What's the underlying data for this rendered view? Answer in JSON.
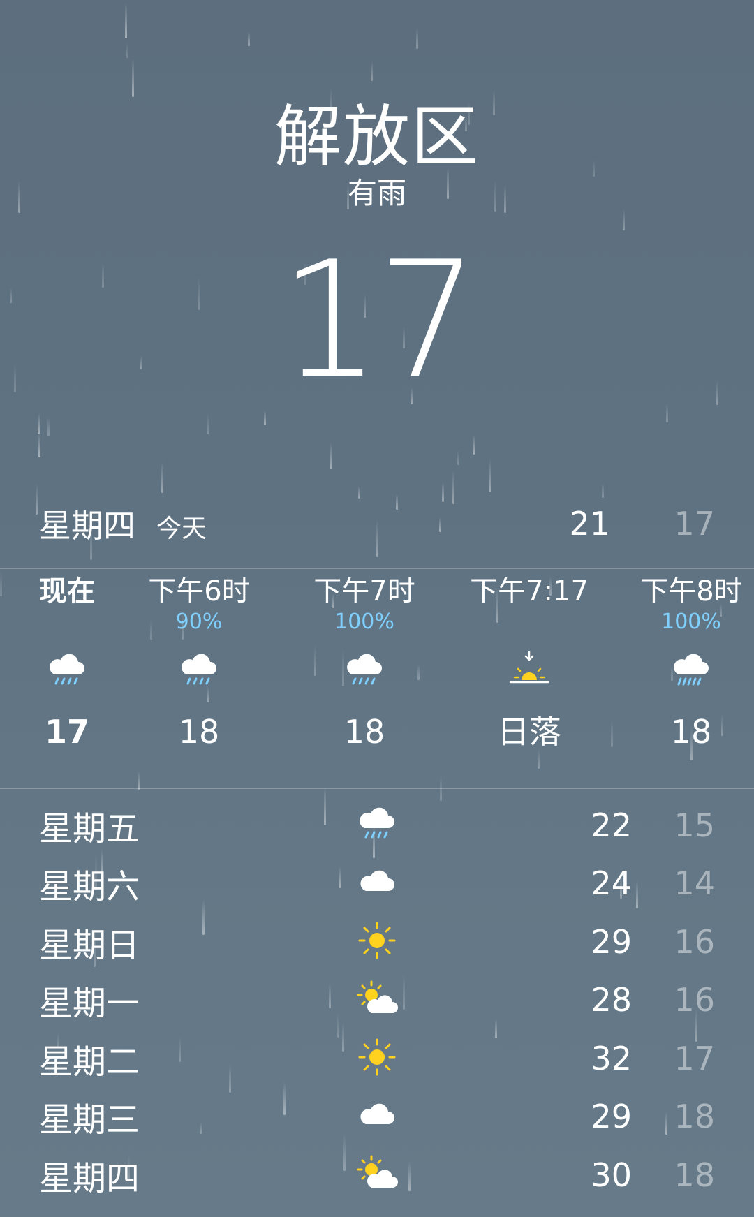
{
  "location": {
    "city": "解放区",
    "condition": "有雨",
    "temperature": "17"
  },
  "today": {
    "day": "星期四",
    "tag": "今天",
    "high": "21",
    "low": "17"
  },
  "hourly": [
    {
      "label": "现在",
      "pop": "",
      "icon": "rain-cloud-icon",
      "temp": "17",
      "bold": true
    },
    {
      "label": "下午6时",
      "pop": "90%",
      "icon": "rain-cloud-icon",
      "temp": "18",
      "bold": false
    },
    {
      "label": "下午7时",
      "pop": "100%",
      "icon": "rain-cloud-icon",
      "temp": "18",
      "bold": false
    },
    {
      "label": "下午7:17",
      "pop": "",
      "icon": "sunset-icon",
      "temp": "日落",
      "bold": false
    },
    {
      "label": "下午8时",
      "pop": "100%",
      "icon": "heavy-rain-cloud-icon",
      "temp": "18",
      "bold": false
    }
  ],
  "daily": [
    {
      "day": "星期五",
      "icon": "rain-cloud-icon",
      "high": "22",
      "low": "15"
    },
    {
      "day": "星期六",
      "icon": "cloud-icon",
      "high": "24",
      "low": "14"
    },
    {
      "day": "星期日",
      "icon": "sun-icon",
      "high": "29",
      "low": "16"
    },
    {
      "day": "星期一",
      "icon": "partly-cloudy-icon",
      "high": "28",
      "low": "16"
    },
    {
      "day": "星期二",
      "icon": "sun-icon",
      "high": "32",
      "low": "17"
    },
    {
      "day": "星期三",
      "icon": "cloud-icon",
      "high": "29",
      "low": "18"
    },
    {
      "day": "星期四",
      "icon": "partly-cloudy-icon",
      "high": "30",
      "low": "18"
    }
  ],
  "colors": {
    "background": "#607483",
    "precip": "#7fd0ff",
    "sun": "#ffd21f",
    "low_temp": "rgba(255,255,255,0.45)"
  }
}
